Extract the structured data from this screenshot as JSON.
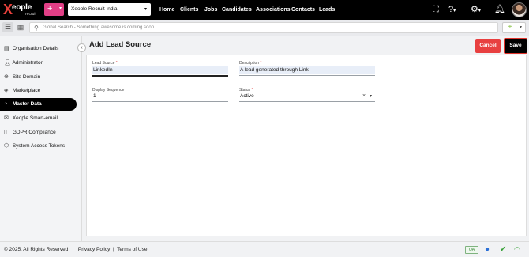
{
  "brand": {
    "letter": "X",
    "name": "eople",
    "sub": "recruit"
  },
  "header": {
    "add_label": "+",
    "company": "Xeople Recruit India",
    "nav": [
      "Home",
      "Clients",
      "Jobs",
      "Candidates",
      "Associations",
      "Contacts",
      "Leads"
    ]
  },
  "search": {
    "placeholder": "Global Search - Something awesome is coming soon",
    "quick_add": "+"
  },
  "sidebar": {
    "items": [
      {
        "label": "Organisation Details",
        "icon": "building-icon"
      },
      {
        "label": "Administrator",
        "icon": "user-icon"
      },
      {
        "label": "Site Domain",
        "icon": "globe-icon"
      },
      {
        "label": "Marketplace",
        "icon": "tag-icon"
      },
      {
        "label": "Master Data",
        "icon": "gauge-icon"
      },
      {
        "label": "Xeople Smart-email",
        "icon": "email-icon"
      },
      {
        "label": "GDPR Compliance",
        "icon": "document-icon"
      },
      {
        "label": "System Access Tokens",
        "icon": "cube-icon"
      }
    ],
    "active_index": 4
  },
  "page": {
    "title": "Add Lead Source",
    "cancel_label": "Cancel",
    "save_label": "Save"
  },
  "form": {
    "lead_source": {
      "label": "Lead Source",
      "value": "LinkedIn"
    },
    "description": {
      "label": "Description",
      "value": "A lead generated through Link"
    },
    "display_sequence": {
      "label": "Display Sequence",
      "value": "1"
    },
    "status": {
      "label": "Status",
      "value": "Active"
    }
  },
  "footer": {
    "copyright": "© 2025. All Rights Reserved   |   Privacy Policy  |  Terms of Use",
    "qa_badge": "QA"
  },
  "colors": {
    "accent_pink": "#e23f86",
    "cancel_red": "#e84040",
    "active_black": "#000000"
  }
}
